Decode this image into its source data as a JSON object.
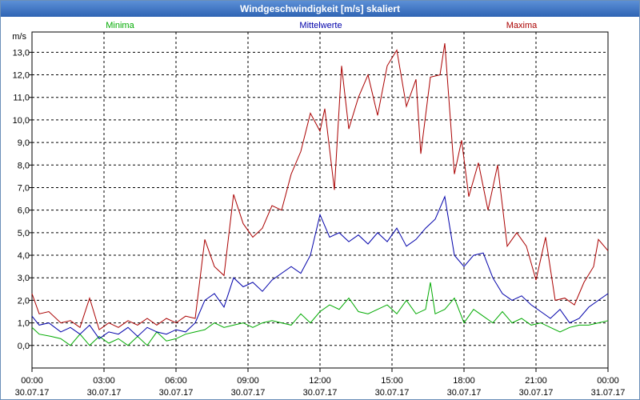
{
  "window": {
    "title": "Windgeschwindigkeit [m/s] skaliert"
  },
  "chart_data": {
    "type": "line",
    "ylabel": "m/s",
    "ylim": [
      -1.0,
      13.9
    ],
    "yticks": [
      "0,0",
      "1,0",
      "2,0",
      "3,0",
      "4,0",
      "5,0",
      "6,0",
      "7,0",
      "8,0",
      "9,0",
      "10,0",
      "11,0",
      "12,0",
      "13,0"
    ],
    "xlim": [
      0,
      24
    ],
    "xticks": [
      {
        "time": "00:00",
        "date": "30.07.17"
      },
      {
        "time": "03:00",
        "date": "30.07.17"
      },
      {
        "time": "06:00",
        "date": "30.07.17"
      },
      {
        "time": "09:00",
        "date": "30.07.17"
      },
      {
        "time": "12:00",
        "date": "30.07.17"
      },
      {
        "time": "15:00",
        "date": "30.07.17"
      },
      {
        "time": "18:00",
        "date": "30.07.17"
      },
      {
        "time": "21:00",
        "date": "30.07.17"
      },
      {
        "time": "00:00",
        "date": "31.07.17"
      }
    ],
    "grid": true,
    "legend_placement": "top",
    "series": [
      {
        "name": "Minima",
        "color": "#00aa00",
        "points": [
          [
            0,
            0.8
          ],
          [
            0.3,
            0.5
          ],
          [
            0.8,
            0.4
          ],
          [
            1.2,
            0.3
          ],
          [
            1.6,
            0.0
          ],
          [
            2.0,
            0.5
          ],
          [
            2.4,
            0.0
          ],
          [
            2.8,
            0.4
          ],
          [
            3.2,
            0.1
          ],
          [
            3.6,
            0.3
          ],
          [
            4.0,
            0.0
          ],
          [
            4.4,
            0.4
          ],
          [
            4.8,
            0.0
          ],
          [
            5.2,
            0.6
          ],
          [
            5.6,
            0.2
          ],
          [
            6.0,
            0.3
          ],
          [
            6.4,
            0.5
          ],
          [
            6.8,
            0.6
          ],
          [
            7.2,
            0.7
          ],
          [
            7.6,
            1.0
          ],
          [
            8.0,
            0.8
          ],
          [
            8.4,
            0.9
          ],
          [
            8.8,
            1.0
          ],
          [
            9.2,
            0.8
          ],
          [
            9.6,
            1.0
          ],
          [
            10.0,
            1.1
          ],
          [
            10.4,
            1.0
          ],
          [
            10.8,
            0.9
          ],
          [
            11.2,
            1.4
          ],
          [
            11.6,
            1.0
          ],
          [
            12.0,
            1.5
          ],
          [
            12.4,
            1.8
          ],
          [
            12.8,
            1.6
          ],
          [
            13.2,
            2.1
          ],
          [
            13.6,
            1.5
          ],
          [
            14.0,
            1.4
          ],
          [
            14.4,
            1.6
          ],
          [
            14.8,
            1.8
          ],
          [
            15.2,
            1.4
          ],
          [
            15.6,
            2.0
          ],
          [
            16.0,
            1.4
          ],
          [
            16.4,
            1.6
          ],
          [
            16.6,
            2.8
          ],
          [
            16.8,
            1.4
          ],
          [
            17.2,
            1.6
          ],
          [
            17.6,
            2.1
          ],
          [
            18.0,
            1.0
          ],
          [
            18.4,
            1.6
          ],
          [
            18.8,
            1.3
          ],
          [
            19.2,
            1.0
          ],
          [
            19.6,
            1.5
          ],
          [
            20.0,
            1.0
          ],
          [
            20.4,
            1.2
          ],
          [
            20.8,
            0.9
          ],
          [
            21.2,
            1.0
          ],
          [
            21.6,
            0.8
          ],
          [
            22.0,
            0.6
          ],
          [
            22.4,
            0.8
          ],
          [
            22.8,
            0.9
          ],
          [
            23.2,
            0.9
          ],
          [
            23.6,
            1.0
          ],
          [
            24.0,
            1.1
          ]
        ]
      },
      {
        "name": "Mittelwerte",
        "color": "#0000aa",
        "points": [
          [
            0,
            1.3
          ],
          [
            0.3,
            0.9
          ],
          [
            0.7,
            1.0
          ],
          [
            1.2,
            0.6
          ],
          [
            1.6,
            0.8
          ],
          [
            2.0,
            0.5
          ],
          [
            2.4,
            0.9
          ],
          [
            2.8,
            0.3
          ],
          [
            3.2,
            0.6
          ],
          [
            3.6,
            0.5
          ],
          [
            4.0,
            0.8
          ],
          [
            4.4,
            0.4
          ],
          [
            4.8,
            0.8
          ],
          [
            5.2,
            0.6
          ],
          [
            5.6,
            0.5
          ],
          [
            6.0,
            0.7
          ],
          [
            6.4,
            0.6
          ],
          [
            6.8,
            1.0
          ],
          [
            7.2,
            2.0
          ],
          [
            7.6,
            2.3
          ],
          [
            8.0,
            1.7
          ],
          [
            8.4,
            3.0
          ],
          [
            8.8,
            2.6
          ],
          [
            9.2,
            2.8
          ],
          [
            9.6,
            2.4
          ],
          [
            10.0,
            2.9
          ],
          [
            10.4,
            3.2
          ],
          [
            10.8,
            3.5
          ],
          [
            11.2,
            3.2
          ],
          [
            11.6,
            4.0
          ],
          [
            12.0,
            5.8
          ],
          [
            12.4,
            4.8
          ],
          [
            12.8,
            5.0
          ],
          [
            13.2,
            4.6
          ],
          [
            13.6,
            4.9
          ],
          [
            14.0,
            4.5
          ],
          [
            14.4,
            5.0
          ],
          [
            14.8,
            4.6
          ],
          [
            15.2,
            5.2
          ],
          [
            15.6,
            4.4
          ],
          [
            16.0,
            4.7
          ],
          [
            16.4,
            5.2
          ],
          [
            16.8,
            5.6
          ],
          [
            17.2,
            6.6
          ],
          [
            17.6,
            4.0
          ],
          [
            18.0,
            3.5
          ],
          [
            18.4,
            4.0
          ],
          [
            18.8,
            4.1
          ],
          [
            19.2,
            3.0
          ],
          [
            19.6,
            2.3
          ],
          [
            20.0,
            2.0
          ],
          [
            20.4,
            2.2
          ],
          [
            20.8,
            1.8
          ],
          [
            21.2,
            1.5
          ],
          [
            21.6,
            1.2
          ],
          [
            22.0,
            1.6
          ],
          [
            22.4,
            1.0
          ],
          [
            22.8,
            1.2
          ],
          [
            23.2,
            1.7
          ],
          [
            23.6,
            2.0
          ],
          [
            24.0,
            2.3
          ]
        ]
      },
      {
        "name": "Maxima",
        "color": "#aa0000",
        "points": [
          [
            0,
            2.3
          ],
          [
            0.3,
            1.4
          ],
          [
            0.7,
            1.5
          ],
          [
            1.2,
            1.0
          ],
          [
            1.6,
            1.1
          ],
          [
            2.0,
            0.8
          ],
          [
            2.4,
            2.1
          ],
          [
            2.8,
            0.7
          ],
          [
            3.2,
            1.0
          ],
          [
            3.6,
            0.8
          ],
          [
            4.0,
            1.1
          ],
          [
            4.4,
            0.9
          ],
          [
            4.8,
            1.2
          ],
          [
            5.2,
            0.9
          ],
          [
            5.6,
            1.2
          ],
          [
            6.0,
            1.0
          ],
          [
            6.4,
            1.3
          ],
          [
            6.8,
            1.2
          ],
          [
            7.2,
            4.7
          ],
          [
            7.6,
            3.5
          ],
          [
            8.0,
            3.1
          ],
          [
            8.4,
            6.7
          ],
          [
            8.8,
            5.4
          ],
          [
            9.2,
            4.8
          ],
          [
            9.6,
            5.2
          ],
          [
            10.0,
            6.2
          ],
          [
            10.4,
            6.0
          ],
          [
            10.8,
            7.6
          ],
          [
            11.2,
            8.6
          ],
          [
            11.6,
            10.3
          ],
          [
            12.0,
            9.5
          ],
          [
            12.2,
            10.5
          ],
          [
            12.6,
            6.9
          ],
          [
            12.9,
            12.4
          ],
          [
            13.2,
            9.6
          ],
          [
            13.6,
            11.0
          ],
          [
            14.0,
            12.0
          ],
          [
            14.4,
            10.2
          ],
          [
            14.8,
            12.4
          ],
          [
            15.2,
            13.1
          ],
          [
            15.6,
            10.6
          ],
          [
            16.0,
            11.8
          ],
          [
            16.2,
            8.5
          ],
          [
            16.6,
            11.9
          ],
          [
            17.0,
            12.0
          ],
          [
            17.2,
            13.4
          ],
          [
            17.6,
            7.6
          ],
          [
            17.9,
            9.1
          ],
          [
            18.2,
            6.6
          ],
          [
            18.6,
            8.1
          ],
          [
            19.0,
            6.0
          ],
          [
            19.4,
            8.0
          ],
          [
            19.8,
            4.4
          ],
          [
            20.2,
            5.0
          ],
          [
            20.6,
            4.4
          ],
          [
            21.0,
            2.9
          ],
          [
            21.4,
            4.8
          ],
          [
            21.8,
            2.0
          ],
          [
            22.2,
            2.1
          ],
          [
            22.6,
            1.8
          ],
          [
            23.0,
            2.8
          ],
          [
            23.4,
            3.5
          ],
          [
            23.6,
            4.7
          ],
          [
            24.0,
            4.2
          ]
        ]
      }
    ]
  }
}
